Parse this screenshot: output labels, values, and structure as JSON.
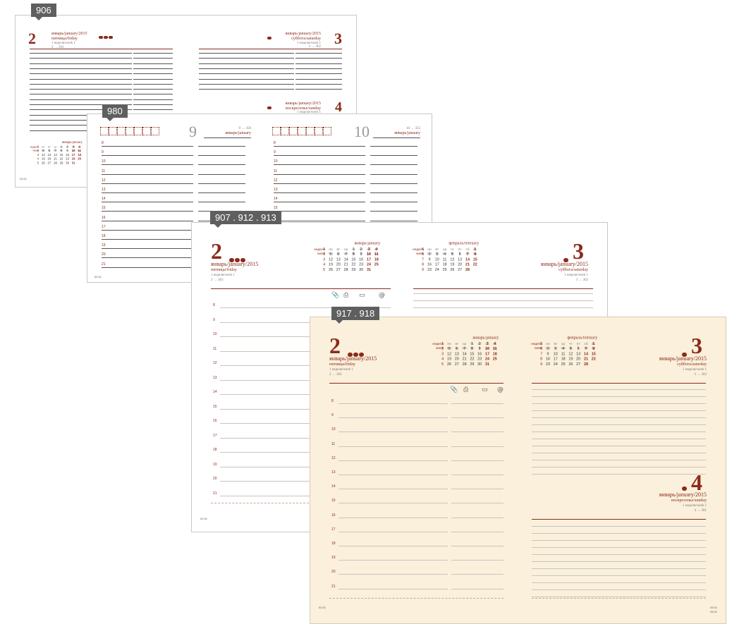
{
  "tags": {
    "p906": "906",
    "p980": "980",
    "p907": "907 . 912 . 913",
    "p917": "917 . 918"
  },
  "dates": {
    "d2": {
      "num": "2",
      "month": "январь/january/2015",
      "weekday": "пятница/friday",
      "week": "1 неделя/week 1",
      "days": "2 → 363"
    },
    "d3": {
      "num": "3",
      "month": "январь/january/2015",
      "weekday": "суббота/saturday",
      "week": "1 неделя/week 1",
      "days": "3 → 362"
    },
    "d4": {
      "num": "4",
      "month": "январь/january/2015",
      "weekday": "воскресенье/sunday",
      "week": "1 неделя/week 1",
      "days": "4 → 361"
    },
    "d9": {
      "num": "9",
      "month": "январь/january",
      "days": "9 → 356"
    },
    "d10": {
      "num": "10",
      "month": "январь/january",
      "days": "10 → 355"
    }
  },
  "cal_jan": {
    "title": "январь/january",
    "wk_head_ru": "неделя",
    "wk_head_en": "week",
    "days_ru": [
      "пн",
      "вт",
      "ср",
      "чт",
      "пт",
      "сб",
      "вс"
    ],
    "days_en": [
      "mo",
      "tu",
      "we",
      "th",
      "fr",
      "sa",
      "su"
    ],
    "rows": [
      {
        "w": "1",
        "d": [
          "",
          "",
          "",
          "1",
          "2",
          "3",
          "4"
        ]
      },
      {
        "w": "2",
        "d": [
          "5",
          "6",
          "7",
          "8",
          "9",
          "10",
          "11"
        ]
      },
      {
        "w": "3",
        "d": [
          "12",
          "13",
          "14",
          "15",
          "16",
          "17",
          "18"
        ]
      },
      {
        "w": "4",
        "d": [
          "19",
          "20",
          "21",
          "22",
          "23",
          "24",
          "25"
        ]
      },
      {
        "w": "5",
        "d": [
          "26",
          "27",
          "28",
          "29",
          "30",
          "31",
          ""
        ]
      }
    ]
  },
  "cal_feb": {
    "title": "февраль/february",
    "rows": [
      {
        "w": "5",
        "d": [
          "",
          "",
          "",
          "",
          "",
          "",
          "1"
        ]
      },
      {
        "w": "6",
        "d": [
          "2",
          "3",
          "4",
          "5",
          "6",
          "7",
          "8"
        ]
      },
      {
        "w": "7",
        "d": [
          "9",
          "10",
          "11",
          "12",
          "13",
          "14",
          "15"
        ]
      },
      {
        "w": "8",
        "d": [
          "16",
          "17",
          "18",
          "19",
          "20",
          "21",
          "22"
        ]
      },
      {
        "w": "9",
        "d": [
          "23",
          "24",
          "25",
          "26",
          "27",
          "28",
          ""
        ]
      }
    ]
  },
  "hours": [
    "8",
    "9",
    "10",
    "11",
    "12",
    "13",
    "14",
    "15",
    "16",
    "17",
    "18",
    "19",
    "20",
    "21"
  ],
  "footers": {
    "f0201": "02.01",
    "f0301": "03.01",
    "f0401": "04.01"
  }
}
